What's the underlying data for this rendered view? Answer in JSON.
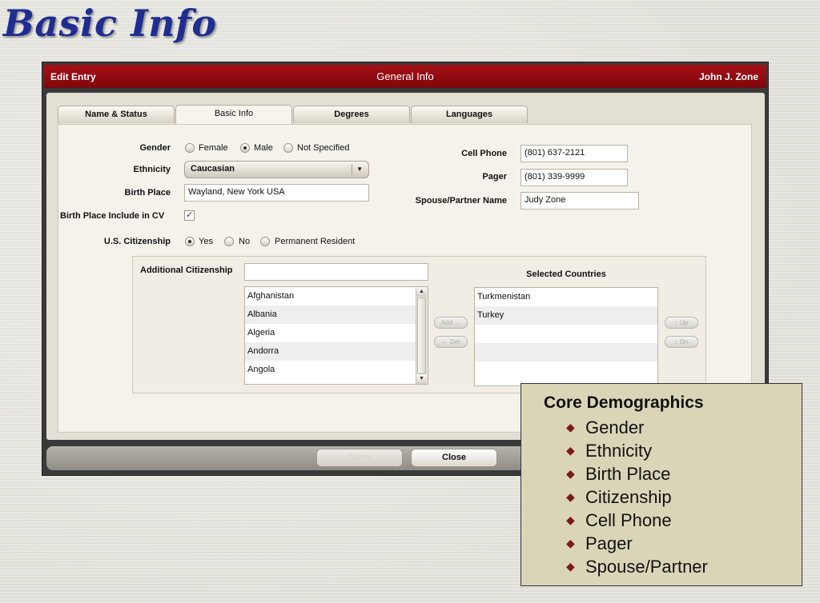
{
  "slide": {
    "title": "Basic Info"
  },
  "window": {
    "title_left": "Edit Entry",
    "title_center": "General Info",
    "title_right": "John J. Zone",
    "accent_color": "#a70f16"
  },
  "tabs": [
    {
      "label": "Name & Status",
      "active": false
    },
    {
      "label": "Basic Info",
      "active": true
    },
    {
      "label": "Degrees",
      "active": false
    },
    {
      "label": "Languages",
      "active": false
    }
  ],
  "form": {
    "gender": {
      "label": "Gender",
      "options": [
        "Female",
        "Male",
        "Not Specified"
      ],
      "selected": "Male"
    },
    "ethnicity": {
      "label": "Ethnicity",
      "value": "Caucasian"
    },
    "birth_place": {
      "label": "Birth Place",
      "value": "Wayland, New York  USA"
    },
    "birth_place_cv": {
      "label": "Birth Place Include in CV",
      "checked": true
    },
    "citizenship": {
      "label": "U.S. Citizenship",
      "options": [
        "Yes",
        "No",
        "Permanent Resident"
      ],
      "selected": "Yes"
    },
    "cell_phone": {
      "label": "Cell Phone",
      "value": "(801) 637-2121"
    },
    "pager": {
      "label": "Pager",
      "value": "(801) 339-9999"
    },
    "spouse": {
      "label": "Spouse/Partner Name",
      "value": "Judy Zone"
    },
    "additional_citizenship": {
      "label": "Additional Citizenship",
      "filter_value": "",
      "countries": [
        "Afghanistan",
        "Albania",
        "Algeria",
        "Andorra",
        "Angola"
      ],
      "add_label": "Add →",
      "del_label": "← Del",
      "selected_header": "Selected Countries",
      "selected": [
        "Turkmenistan",
        "Turkey"
      ],
      "up_label": "↑ Up",
      "down_label": "↓ Dn"
    }
  },
  "footer": {
    "save_label": "Save",
    "close_label": "Close"
  },
  "callout": {
    "heading": "Core Demographics",
    "items": [
      "Gender",
      "Ethnicity",
      "Birth Place",
      "Citizenship",
      "Cell Phone",
      "Pager",
      "Spouse/Partner"
    ]
  }
}
